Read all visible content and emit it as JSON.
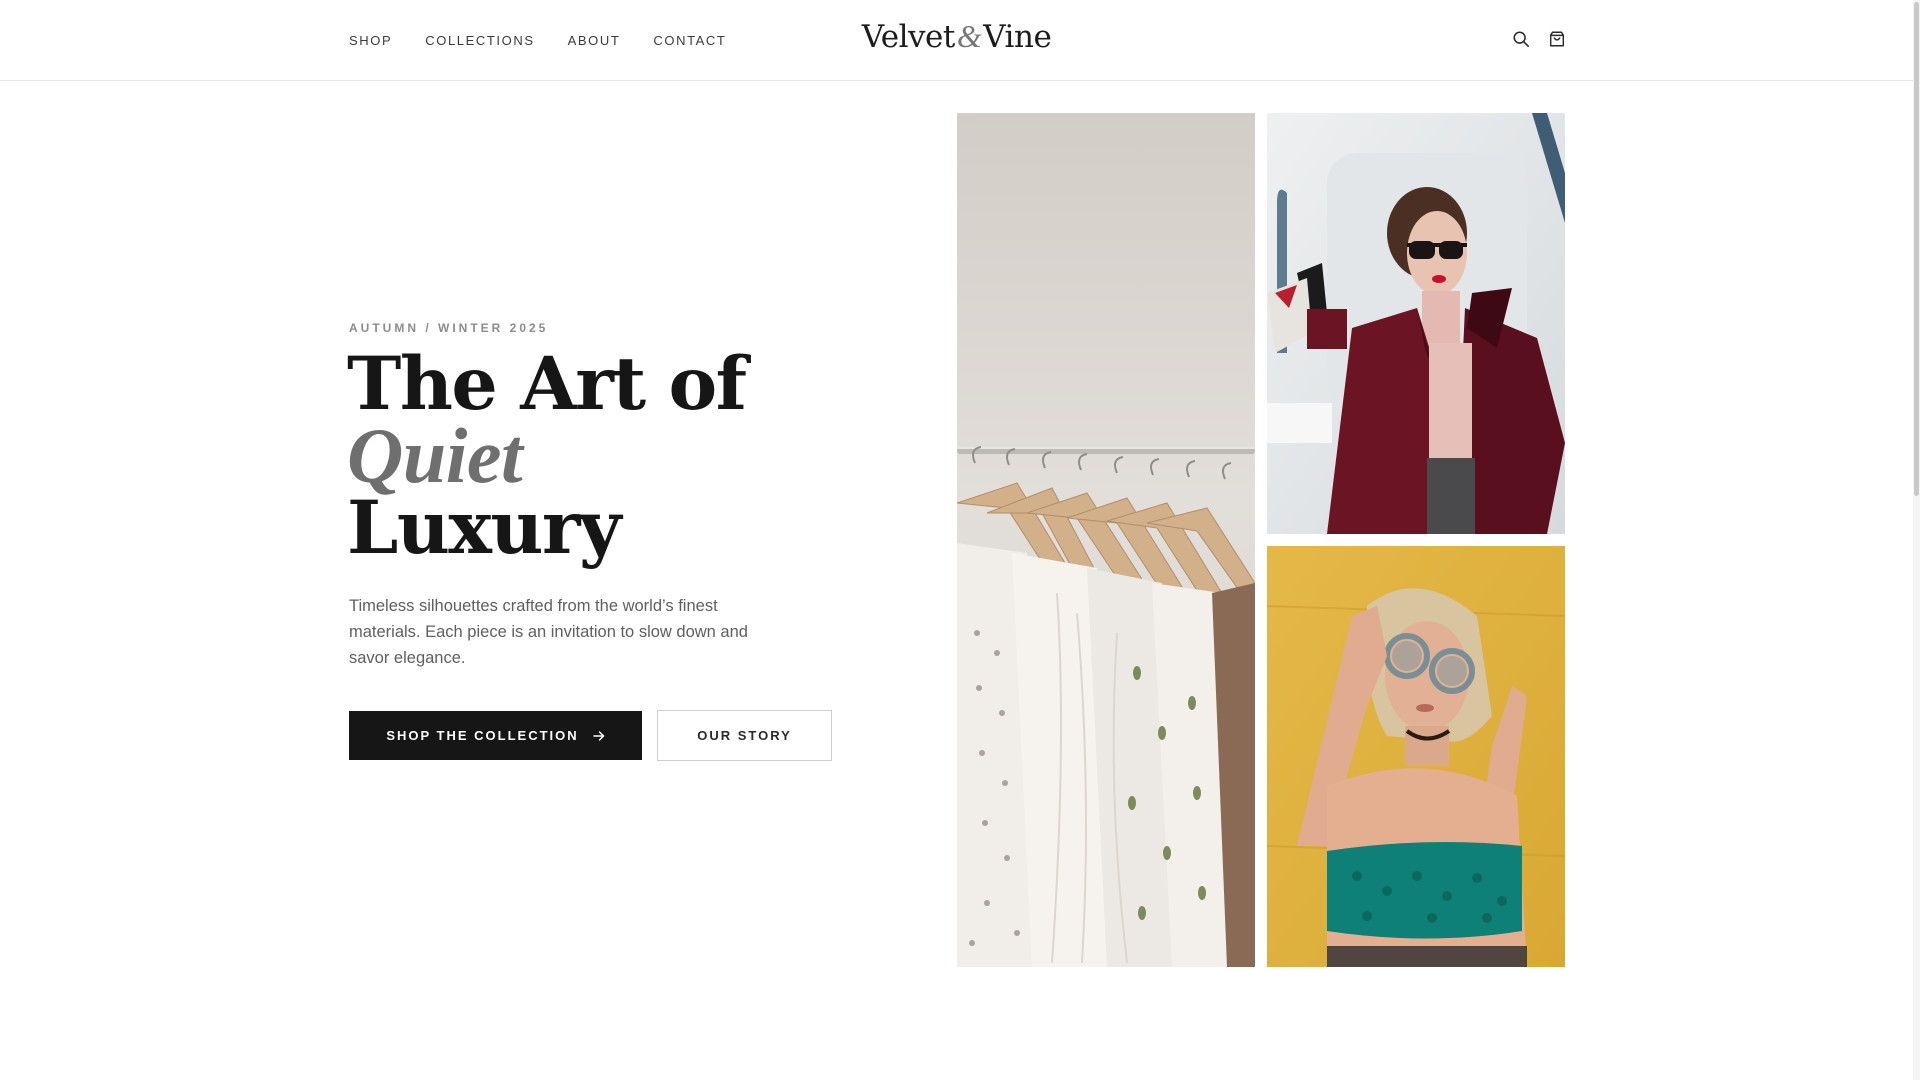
{
  "header": {
    "nav": [
      {
        "label": "SHOP"
      },
      {
        "label": "COLLECTIONS"
      },
      {
        "label": "ABOUT"
      },
      {
        "label": "CONTACT"
      }
    ],
    "brand": {
      "first": "Velvet",
      "amp": "&",
      "second": "Vine"
    },
    "icons": [
      "search-icon",
      "shopping-bag-icon"
    ]
  },
  "hero": {
    "eyebrow": "AUTUMN / WINTER 2025",
    "headline": {
      "line1": "The Art of",
      "accent": "Quiet",
      "line3": "Luxury"
    },
    "description": "Timeless silhouettes crafted from the world’s finest materials. Each piece is an invitation to slow down and savor elegance.",
    "primary_cta": "SHOP THE COLLECTION",
    "secondary_cta": "OUR STORY"
  },
  "gallery": {
    "images": [
      {
        "subject": "clothing-rack-photo"
      },
      {
        "subject": "model-burgundy-coat-photo"
      },
      {
        "subject": "model-round-glasses-photo"
      }
    ]
  },
  "colors": {
    "text_primary": "#161616",
    "text_muted": "#5f5f5f",
    "accent_gray": "#6f6f6f",
    "button_dark": "#161616",
    "coat_burgundy": "#6b1424",
    "backdrop_yellow": "#e2b33f",
    "top_teal": "#0f8077"
  }
}
